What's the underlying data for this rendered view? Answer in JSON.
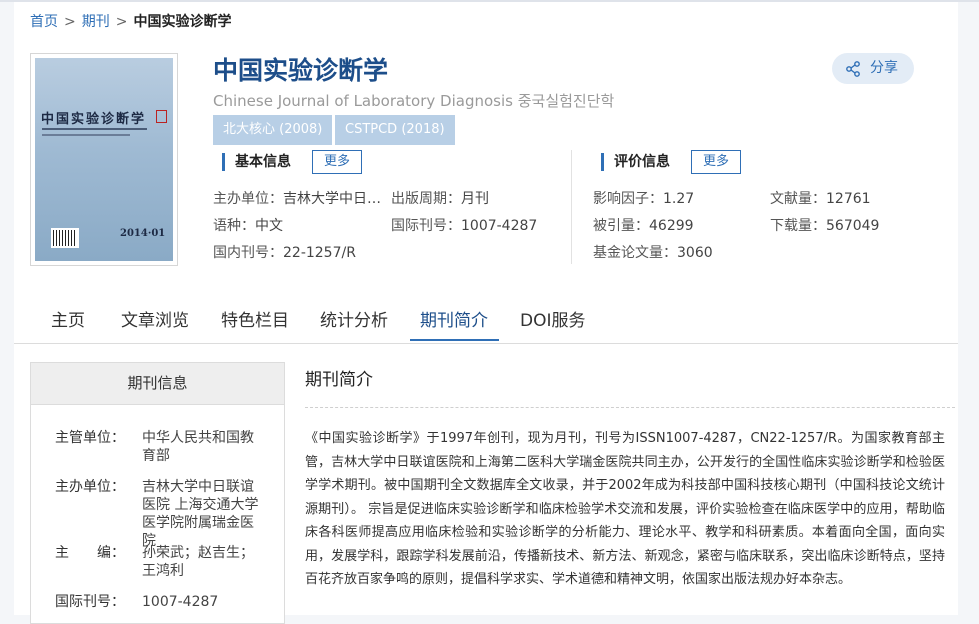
{
  "breadcrumb": {
    "home": "首页",
    "sep1": ">",
    "journals": "期刊",
    "sep2": ">",
    "current": "中国实验诊断学"
  },
  "cover": {
    "title": "中国实验诊断学",
    "year": "2014·01"
  },
  "journal": {
    "title": "中国实验诊断学",
    "subtitle": "Chinese Journal of Laboratory Diagnosis 중국실험진단학",
    "badges": [
      "北大核心 (2008)",
      "CSTPCD (2018)"
    ],
    "share": "分享"
  },
  "basic": {
    "header": "基本信息",
    "more": "更多",
    "sponsor_k": "主办单位：",
    "sponsor_v": "吉林大学中日…",
    "period_k": "出版周期：",
    "period_v": "月刊",
    "lang_k": "语种：",
    "lang_v": "中文",
    "issn_k": "国际刊号：",
    "issn_v": "1007-4287",
    "cn_k": "国内刊号：",
    "cn_v": "22-1257/R"
  },
  "eval": {
    "header": "评价信息",
    "more": "更多",
    "if_k": "影响因子：",
    "if_v": "1.27",
    "docs_k": "文献量：",
    "docs_v": "12761",
    "cited_k": "被引量：",
    "cited_v": "46299",
    "dl_k": "下载量：",
    "dl_v": "567049",
    "fund_k": "基金论文量：",
    "fund_v": "3060"
  },
  "tabs": [
    "主页",
    "文章浏览",
    "特色栏目",
    "统计分析",
    "期刊简介",
    "DOI服务"
  ],
  "side": {
    "header": "期刊信息",
    "rows": [
      {
        "k": "主管单位：",
        "v": "中华人民共和国教育部"
      },
      {
        "k": "主办单位：",
        "v": "吉林大学中日联谊医院 上海交通大学医学院附属瑞金医院"
      },
      {
        "k": "主　　编：",
        "v": "孙荣武；赵吉生；王鸿利"
      },
      {
        "k": "国际刊号：",
        "v": "1007-4287"
      }
    ]
  },
  "intro": {
    "heading": "期刊简介",
    "text": "《中国实验诊断学》于1997年创刊，现为月刊，刊号为ISSN1007-4287，CN22-1257/R。为国家教育部主管，吉林大学中日联谊医院和上海第二医科大学瑞金医院共同主办，公开发行的全国性临床实验诊断学和检验医学学术期刊。被中国期刊全文数据库全文收录，并于2002年成为科技部中国科技核心期刊（中国科技论文统计源期刊）。 宗旨是促进临床实验诊断学和临床检验学术交流和发展，评价实验检查在临床医学中的应用，帮助临床各科医师提高应用临床检验和实验诊断学的分析能力、理论水平、教学和科研素质。本着面向全国，面向实用，发展学科，跟踪学科发展前沿，传播新技术、新方法、新观念，紧密与临床联系，突出临床诊断特点，坚持百花齐放百家争鸣的原则，提倡科学求实、学术道德和精神文明，依国家出版法规办好本杂志。"
  }
}
